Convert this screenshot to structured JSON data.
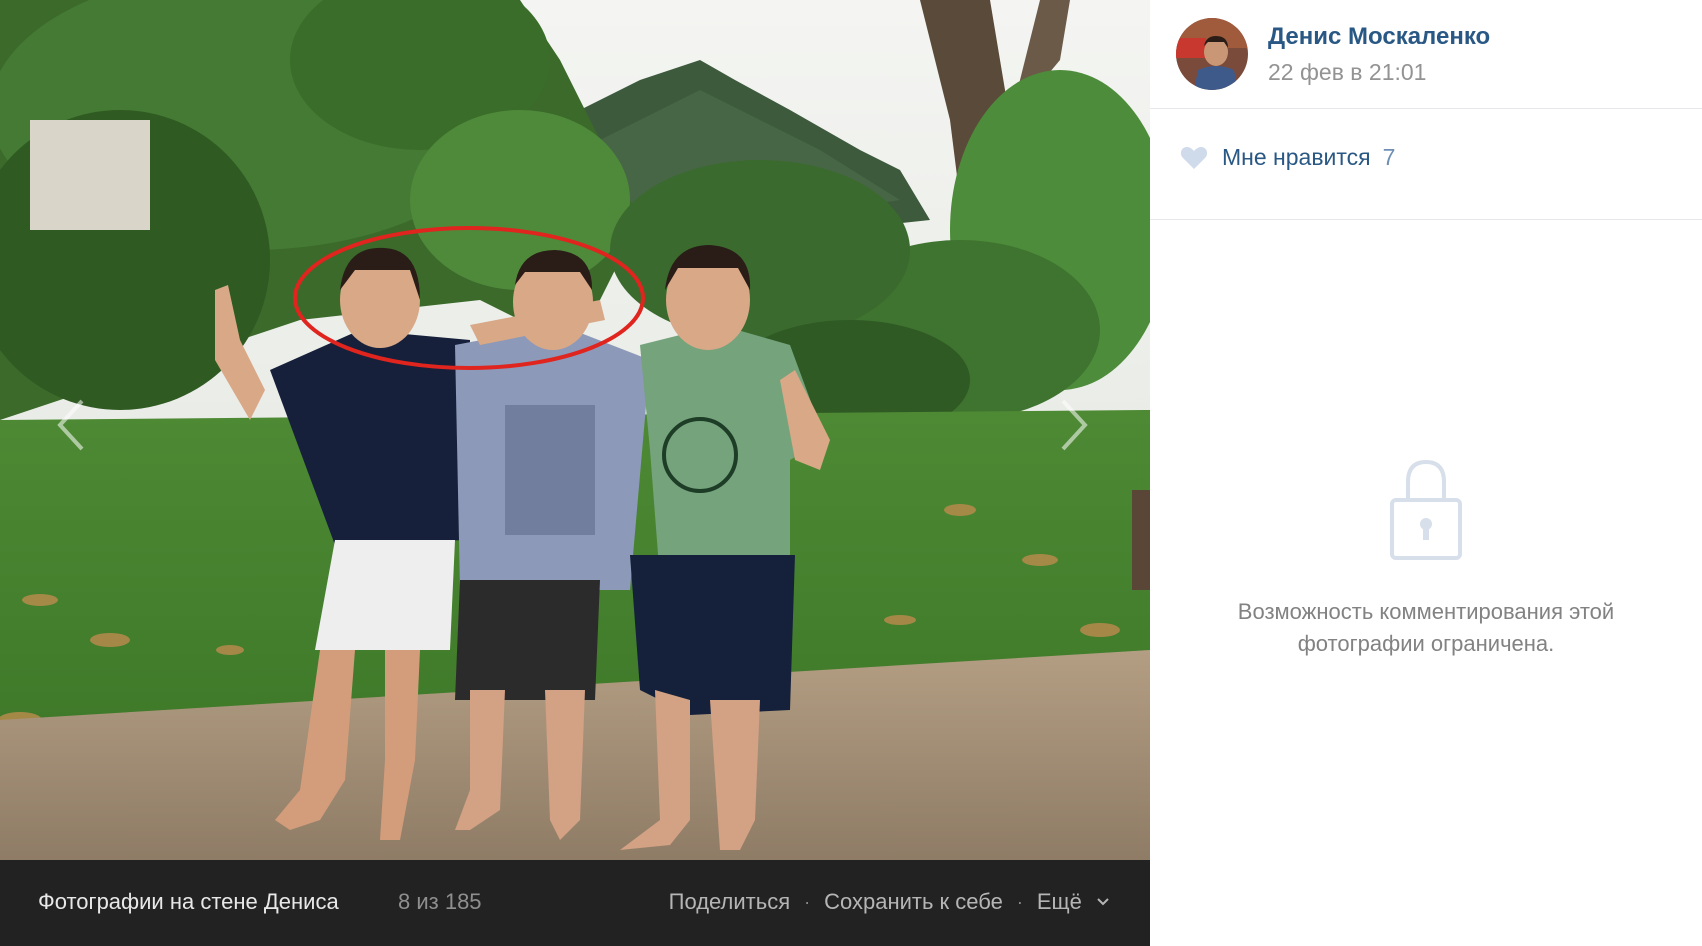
{
  "author": {
    "name": "Денис Москаленко",
    "date": "22 фев в 21:01"
  },
  "likes": {
    "label": "Мне нравится",
    "count": "7"
  },
  "comments": {
    "restricted_line1": "Возможность комментирования этой",
    "restricted_line2": "фотографии ограничена."
  },
  "bottom_bar": {
    "album_title": "Фотографии на стене Дениса",
    "counter": "8 из 185",
    "share": "Поделиться",
    "save": "Сохранить к себе",
    "more": "Ещё",
    "separator": "·"
  },
  "icons": {
    "like": "heart-icon",
    "lock": "lock-icon",
    "prev": "chevron-left-icon",
    "next": "chevron-right-icon",
    "more": "chevron-down-icon"
  },
  "colors": {
    "link": "#2a5885",
    "bottom_bar": "#222222",
    "annotation": "#e0241e"
  }
}
